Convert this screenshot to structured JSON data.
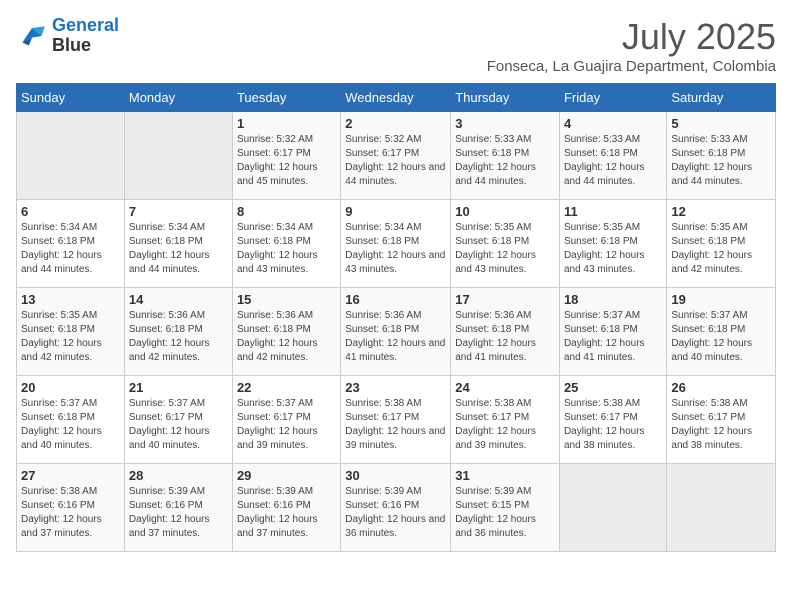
{
  "app": {
    "name": "GeneralBlue",
    "logo_icon": "bird"
  },
  "header": {
    "month_year": "July 2025",
    "location": "Fonseca, La Guajira Department, Colombia"
  },
  "weekdays": [
    "Sunday",
    "Monday",
    "Tuesday",
    "Wednesday",
    "Thursday",
    "Friday",
    "Saturday"
  ],
  "weeks": [
    [
      {
        "day": "",
        "info": ""
      },
      {
        "day": "",
        "info": ""
      },
      {
        "day": "1",
        "info": "Sunrise: 5:32 AM\nSunset: 6:17 PM\nDaylight: 12 hours and 45 minutes."
      },
      {
        "day": "2",
        "info": "Sunrise: 5:32 AM\nSunset: 6:17 PM\nDaylight: 12 hours and 44 minutes."
      },
      {
        "day": "3",
        "info": "Sunrise: 5:33 AM\nSunset: 6:18 PM\nDaylight: 12 hours and 44 minutes."
      },
      {
        "day": "4",
        "info": "Sunrise: 5:33 AM\nSunset: 6:18 PM\nDaylight: 12 hours and 44 minutes."
      },
      {
        "day": "5",
        "info": "Sunrise: 5:33 AM\nSunset: 6:18 PM\nDaylight: 12 hours and 44 minutes."
      }
    ],
    [
      {
        "day": "6",
        "info": "Sunrise: 5:34 AM\nSunset: 6:18 PM\nDaylight: 12 hours and 44 minutes."
      },
      {
        "day": "7",
        "info": "Sunrise: 5:34 AM\nSunset: 6:18 PM\nDaylight: 12 hours and 44 minutes."
      },
      {
        "day": "8",
        "info": "Sunrise: 5:34 AM\nSunset: 6:18 PM\nDaylight: 12 hours and 43 minutes."
      },
      {
        "day": "9",
        "info": "Sunrise: 5:34 AM\nSunset: 6:18 PM\nDaylight: 12 hours and 43 minutes."
      },
      {
        "day": "10",
        "info": "Sunrise: 5:35 AM\nSunset: 6:18 PM\nDaylight: 12 hours and 43 minutes."
      },
      {
        "day": "11",
        "info": "Sunrise: 5:35 AM\nSunset: 6:18 PM\nDaylight: 12 hours and 43 minutes."
      },
      {
        "day": "12",
        "info": "Sunrise: 5:35 AM\nSunset: 6:18 PM\nDaylight: 12 hours and 42 minutes."
      }
    ],
    [
      {
        "day": "13",
        "info": "Sunrise: 5:35 AM\nSunset: 6:18 PM\nDaylight: 12 hours and 42 minutes."
      },
      {
        "day": "14",
        "info": "Sunrise: 5:36 AM\nSunset: 6:18 PM\nDaylight: 12 hours and 42 minutes."
      },
      {
        "day": "15",
        "info": "Sunrise: 5:36 AM\nSunset: 6:18 PM\nDaylight: 12 hours and 42 minutes."
      },
      {
        "day": "16",
        "info": "Sunrise: 5:36 AM\nSunset: 6:18 PM\nDaylight: 12 hours and 41 minutes."
      },
      {
        "day": "17",
        "info": "Sunrise: 5:36 AM\nSunset: 6:18 PM\nDaylight: 12 hours and 41 minutes."
      },
      {
        "day": "18",
        "info": "Sunrise: 5:37 AM\nSunset: 6:18 PM\nDaylight: 12 hours and 41 minutes."
      },
      {
        "day": "19",
        "info": "Sunrise: 5:37 AM\nSunset: 6:18 PM\nDaylight: 12 hours and 40 minutes."
      }
    ],
    [
      {
        "day": "20",
        "info": "Sunrise: 5:37 AM\nSunset: 6:18 PM\nDaylight: 12 hours and 40 minutes."
      },
      {
        "day": "21",
        "info": "Sunrise: 5:37 AM\nSunset: 6:17 PM\nDaylight: 12 hours and 40 minutes."
      },
      {
        "day": "22",
        "info": "Sunrise: 5:37 AM\nSunset: 6:17 PM\nDaylight: 12 hours and 39 minutes."
      },
      {
        "day": "23",
        "info": "Sunrise: 5:38 AM\nSunset: 6:17 PM\nDaylight: 12 hours and 39 minutes."
      },
      {
        "day": "24",
        "info": "Sunrise: 5:38 AM\nSunset: 6:17 PM\nDaylight: 12 hours and 39 minutes."
      },
      {
        "day": "25",
        "info": "Sunrise: 5:38 AM\nSunset: 6:17 PM\nDaylight: 12 hours and 38 minutes."
      },
      {
        "day": "26",
        "info": "Sunrise: 5:38 AM\nSunset: 6:17 PM\nDaylight: 12 hours and 38 minutes."
      }
    ],
    [
      {
        "day": "27",
        "info": "Sunrise: 5:38 AM\nSunset: 6:16 PM\nDaylight: 12 hours and 37 minutes."
      },
      {
        "day": "28",
        "info": "Sunrise: 5:39 AM\nSunset: 6:16 PM\nDaylight: 12 hours and 37 minutes."
      },
      {
        "day": "29",
        "info": "Sunrise: 5:39 AM\nSunset: 6:16 PM\nDaylight: 12 hours and 37 minutes."
      },
      {
        "day": "30",
        "info": "Sunrise: 5:39 AM\nSunset: 6:16 PM\nDaylight: 12 hours and 36 minutes."
      },
      {
        "day": "31",
        "info": "Sunrise: 5:39 AM\nSunset: 6:15 PM\nDaylight: 12 hours and 36 minutes."
      },
      {
        "day": "",
        "info": ""
      },
      {
        "day": "",
        "info": ""
      }
    ]
  ]
}
